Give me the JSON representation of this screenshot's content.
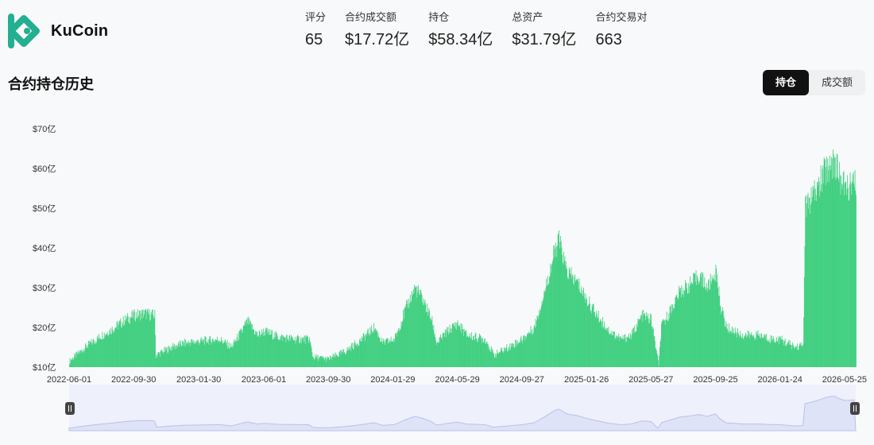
{
  "header": {
    "logo_text": "KuCoin",
    "stats": [
      {
        "label": "评分",
        "value": "65"
      },
      {
        "label": "合约成交额",
        "value": "$17.72亿"
      },
      {
        "label": "持仓",
        "value": "$58.34亿"
      },
      {
        "label": "总资产",
        "value": "$31.79亿"
      },
      {
        "label": "合约交易对",
        "value": "663"
      }
    ]
  },
  "section": {
    "title": "合约持仓历史",
    "toggle": [
      {
        "label": "持仓",
        "active": true
      },
      {
        "label": "成交额",
        "active": false
      }
    ]
  },
  "colors": {
    "bar": "#3fcf7f",
    "brand": "#23af91",
    "navigator_fill": "#dfe3f8",
    "navigator_line": "#b9c0ea"
  },
  "chart_data": {
    "type": "bar",
    "title": "",
    "xlabel": "",
    "ylabel": "",
    "y_tick_labels": [
      "$10亿",
      "$20亿",
      "$30亿",
      "$40亿",
      "$50亿",
      "$60亿",
      "$70亿"
    ],
    "y_tick_values": [
      10,
      20,
      30,
      40,
      50,
      60,
      70
    ],
    "ylim": [
      10,
      70
    ],
    "x_tick_labels": [
      "2022-06-01",
      "2022-09-30",
      "2023-01-30",
      "2023-06-01",
      "2023-09-30",
      "2024-01-29",
      "2024-05-29",
      "2024-09-27",
      "2025-01-26",
      "2025-05-27",
      "2025-09-25",
      "2026-01-24",
      "2026-05-25"
    ],
    "x_range": [
      "2022-06-01",
      "2026-06-15"
    ],
    "series": [
      {
        "name": "",
        "points": [
          [
            "2022-06-01",
            11.5
          ],
          [
            "2022-07-01",
            15
          ],
          [
            "2022-08-01",
            18
          ],
          [
            "2022-08-20",
            19.5
          ],
          [
            "2022-09-15",
            22
          ],
          [
            "2022-09-30",
            23
          ],
          [
            "2022-10-20",
            23.5
          ],
          [
            "2022-11-08",
            23
          ],
          [
            "2022-11-10",
            13
          ],
          [
            "2022-12-10",
            15
          ],
          [
            "2023-01-01",
            16
          ],
          [
            "2023-02-01",
            16.5
          ],
          [
            "2023-03-10",
            17
          ],
          [
            "2023-04-01",
            15
          ],
          [
            "2023-04-20",
            19
          ],
          [
            "2023-05-01",
            21.5
          ],
          [
            "2023-05-20",
            18
          ],
          [
            "2023-06-01",
            19
          ],
          [
            "2023-07-01",
            17.5
          ],
          [
            "2023-08-01",
            17
          ],
          [
            "2023-08-25",
            17
          ],
          [
            "2023-09-01",
            12.5
          ],
          [
            "2023-09-30",
            12
          ],
          [
            "2023-11-01",
            14
          ],
          [
            "2023-12-01",
            17
          ],
          [
            "2023-12-25",
            20
          ],
          [
            "2024-01-10",
            16
          ],
          [
            "2024-02-01",
            17
          ],
          [
            "2024-02-20",
            24
          ],
          [
            "2024-03-10",
            30
          ],
          [
            "2024-03-25",
            27
          ],
          [
            "2024-04-10",
            22
          ],
          [
            "2024-04-20",
            16
          ],
          [
            "2024-05-10",
            19
          ],
          [
            "2024-05-29",
            21
          ],
          [
            "2024-06-15",
            18
          ],
          [
            "2024-07-20",
            17
          ],
          [
            "2024-08-05",
            13
          ],
          [
            "2024-09-01",
            15
          ],
          [
            "2024-09-27",
            17
          ],
          [
            "2024-10-20",
            20
          ],
          [
            "2024-11-10",
            30
          ],
          [
            "2024-11-25",
            38
          ],
          [
            "2024-12-05",
            42
          ],
          [
            "2024-12-20",
            34
          ],
          [
            "2025-01-10",
            31
          ],
          [
            "2025-01-26",
            27
          ],
          [
            "2025-02-15",
            23
          ],
          [
            "2025-03-10",
            19
          ],
          [
            "2025-04-01",
            17
          ],
          [
            "2025-04-20",
            18
          ],
          [
            "2025-05-10",
            23
          ],
          [
            "2025-05-27",
            22
          ],
          [
            "2025-06-10",
            10.5
          ],
          [
            "2025-06-15",
            20
          ],
          [
            "2025-07-01",
            24
          ],
          [
            "2025-07-20",
            29
          ],
          [
            "2025-08-10",
            31
          ],
          [
            "2025-08-25",
            33
          ],
          [
            "2025-09-10",
            30
          ],
          [
            "2025-09-25",
            34
          ],
          [
            "2025-10-05",
            25
          ],
          [
            "2025-10-15",
            20
          ],
          [
            "2025-11-15",
            18
          ],
          [
            "2025-12-15",
            18
          ],
          [
            "2026-01-10",
            17
          ],
          [
            "2026-01-24",
            17
          ],
          [
            "2026-02-20",
            15
          ],
          [
            "2026-03-08",
            15.5
          ],
          [
            "2026-03-12",
            50
          ],
          [
            "2026-04-01",
            54
          ],
          [
            "2026-04-20",
            60
          ],
          [
            "2026-05-05",
            62
          ],
          [
            "2026-05-15",
            58
          ],
          [
            "2026-05-25",
            55
          ],
          [
            "2026-06-15",
            56
          ]
        ]
      }
    ],
    "grid": false,
    "legend": "none"
  }
}
